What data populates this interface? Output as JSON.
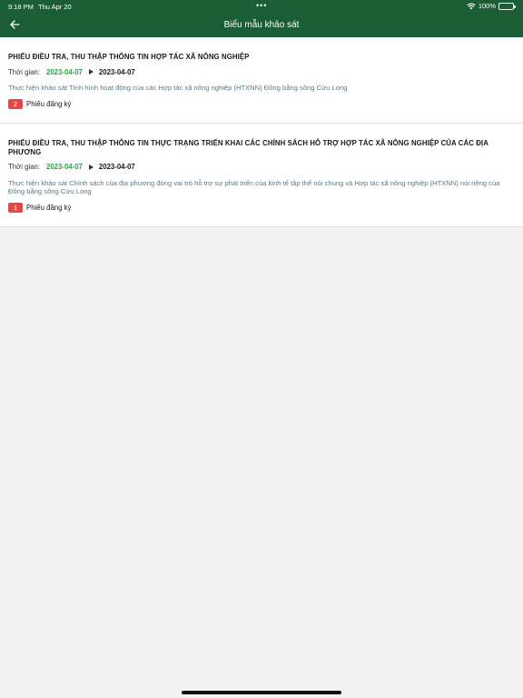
{
  "status": {
    "time": "9:18 PM",
    "date": "Thu Apr 20",
    "dots": "•••",
    "battery": "100%",
    "wifi_icon": "wifi-icon",
    "battery_icon": "battery-icon"
  },
  "header": {
    "title": "Biểu mẫu khảo sát",
    "back_icon": "arrow-left-icon",
    "background": "#1b5e36"
  },
  "surveys": [
    {
      "title": "PHIẾU ĐIỀU TRA, THU THẬP THÔNG TIN HỢP TÁC XÃ NÔNG NGHIỆP",
      "time_label": "Thời gian:",
      "start_date": "2023-04-07",
      "end_date": "2023-04-07",
      "description": "Thực hiện khảo sát Tình hình hoạt động của các Hợp tác xã nông nghiệp (HTXNN) Đồng bằng sông Cửu Long",
      "registration_count": "2",
      "registration_label": "Phiếu đăng ký"
    },
    {
      "title": "PHIẾU ĐIỀU TRA, THU THẬP THÔNG TIN THỰC TRẠNG TRIỂN KHAI CÁC CHÍNH SÁCH HỖ TRỢ HỢP TÁC XÃ NÔNG NGHIỆP CỦA CÁC ĐỊA PHƯƠNG",
      "time_label": "Thời gian:",
      "start_date": "2023-04-07",
      "end_date": "2023-04-07",
      "description": "Thực hiện khảo sát Chính sách của địa phương đóng vai trò hỗ trợ sự phát triển của kinh tế tập thể nói chung và Hợp tác xã nông nghiệp (HTXNN) nói riêng của Đồng bằng sông Cửu Long",
      "registration_count": "1",
      "registration_label": "Phiếu đăng ký"
    }
  ],
  "colors": {
    "accent_green": "#2e9e4a",
    "badge_red": "#e84545",
    "description": "#5a7a86"
  }
}
